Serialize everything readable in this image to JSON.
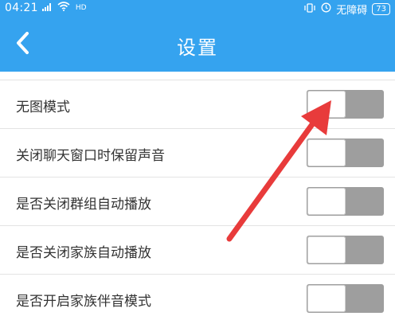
{
  "status_bar": {
    "time": "04:21",
    "signal_text": "4G",
    "network_label": "HD",
    "accessibility_label": "无障碍",
    "battery": "73",
    "icons": [
      "signal-icon",
      "wifi-icon",
      "vibrate-icon",
      "alarm-icon",
      "battery-icon"
    ]
  },
  "header": {
    "title": "设置",
    "back_icon": "chevron-left-icon"
  },
  "settings": [
    {
      "label": "无图模式",
      "enabled": false
    },
    {
      "label": "关闭聊天窗口时保留声音",
      "enabled": false
    },
    {
      "label": "是否关闭群组自动播放",
      "enabled": false
    },
    {
      "label": "是否关闭家族自动播放",
      "enabled": false
    },
    {
      "label": "是否开启家族伴音模式",
      "enabled": false
    }
  ],
  "annotation": {
    "type": "red-arrow",
    "color": "#e83b3b",
    "points_to": "settings.0.toggle"
  },
  "colors": {
    "primary": "#35a3ef",
    "toggle_off_track": "#9e9e9e",
    "divider": "#e3e3e3",
    "text": "#333333"
  }
}
